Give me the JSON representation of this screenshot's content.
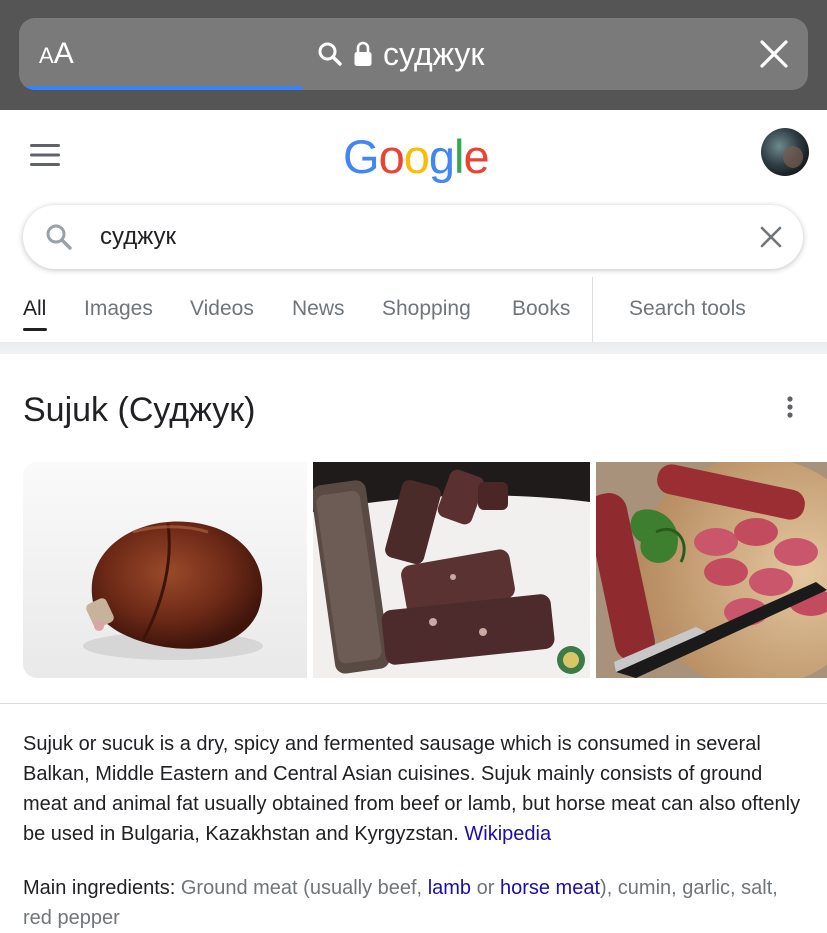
{
  "browser": {
    "text_size_label_small": "A",
    "text_size_label_large": "A",
    "url_text": "суджук",
    "load_progress_fraction": 0.36
  },
  "google": {
    "logo_letters": [
      "G",
      "o",
      "o",
      "g",
      "l",
      "e"
    ],
    "logo_colors": [
      "#4285F4",
      "#EA4335",
      "#FBBC05",
      "#4285F4",
      "#34A853",
      "#EA4335"
    ]
  },
  "search": {
    "query": "суджук"
  },
  "tabs": [
    {
      "label": "All",
      "active": true
    },
    {
      "label": "Images",
      "active": false
    },
    {
      "label": "Videos",
      "active": false
    },
    {
      "label": "News",
      "active": false
    },
    {
      "label": "Shopping",
      "active": false
    },
    {
      "label": "Books",
      "active": false
    }
  ],
  "search_tools_label": "Search tools",
  "knowledge_panel": {
    "title": "Sujuk (Суджук)",
    "description": "Sujuk or sucuk is a dry, spicy and fermented sausage which is consumed in several Balkan, Middle Eastern and Central Asian cuisines. Sujuk mainly consists of ground meat and animal fat usually obtained from beef or lamb, but horse meat can also oftenly be used in Bulgaria, Kazakhstan and Kyrgyzstan.",
    "source_link": "Wikipedia",
    "ingredients_label": "Main ingredients:",
    "ingredients_text_1": "Ground meat (usually beef,",
    "ingredients_link_1": "lamb",
    "ingredients_text_2": "or",
    "ingredients_link_2": "horse meat",
    "ingredients_text_3": "), cumin, garlic, salt, red pepper"
  },
  "colors": {
    "accent_link": "#1a0dab",
    "progress_bar": "#3b82f6"
  }
}
